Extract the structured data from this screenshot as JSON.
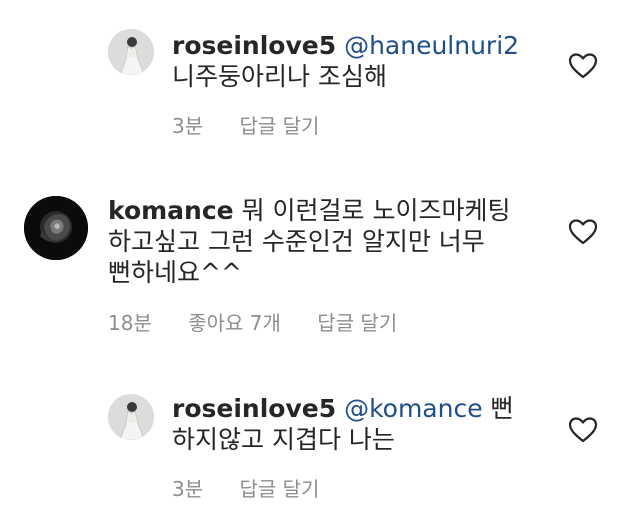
{
  "comments": [
    {
      "username": "roseinlove5",
      "mention": "@haneulnuri2",
      "line1_text": "",
      "line2": "니주둥아리나 조심해",
      "line3": "",
      "time": "3분",
      "likes": "",
      "reply": "답글 달기",
      "avatar": "rose-bride-avatar"
    },
    {
      "username": "komance",
      "mention": "",
      "line1_text": " 뭐 이런걸로 노이즈마케팅",
      "line2": "하고싶고 그런 수준인건 알지만 너무",
      "line3": "뻔하네요^^",
      "time": "18분",
      "likes": "좋아요 7개",
      "reply": "답글 달기",
      "avatar": "black-rose-avatar"
    },
    {
      "username": "roseinlove5",
      "mention": "@komance",
      "line1_text": " 뻔",
      "line2": "하지않고 지겹다 나는",
      "line3": "",
      "time": "3분",
      "likes": "",
      "reply": "답글 달기",
      "avatar": "rose-bride-avatar"
    }
  ],
  "icons": {
    "like": "heart-outline-icon"
  },
  "colors": {
    "mention": "#1f4f86",
    "meta": "#8e8e8e",
    "text": "#262626"
  }
}
